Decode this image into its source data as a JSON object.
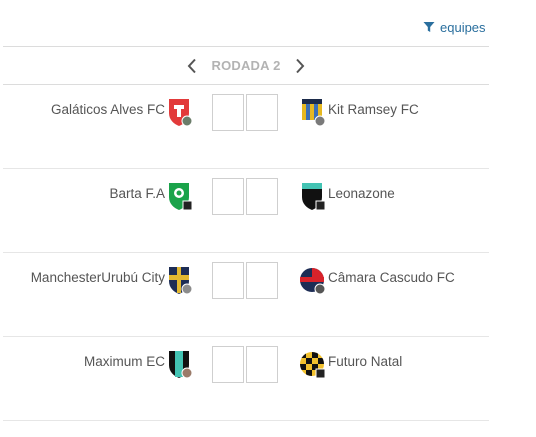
{
  "filter": {
    "label": "equipes",
    "icon": "filter-icon",
    "color": "#2a6f9e"
  },
  "round": {
    "title": "RODADA 2",
    "prev_icon": "chevron-left-icon",
    "next_icon": "chevron-right-icon"
  },
  "matches": [
    {
      "home": {
        "name": "Galáticos Alves FC",
        "crest": "red-white-crest"
      },
      "home_score": "",
      "away_score": "",
      "away": {
        "name": "Kit Ramsey FC",
        "crest": "striped-blue-yellow-crest"
      }
    },
    {
      "home": {
        "name": "Barta F.A",
        "crest": "green-crest"
      },
      "home_score": "",
      "away_score": "",
      "away": {
        "name": "Leonazone",
        "crest": "black-teal-crest"
      }
    },
    {
      "home": {
        "name": "ManchesterUrubú City",
        "crest": "navy-gold-crest"
      },
      "home_score": "",
      "away_score": "",
      "away": {
        "name": "Câmara Cascudo FC",
        "crest": "red-navy-crest"
      }
    },
    {
      "home": {
        "name": "Maximum EC",
        "crest": "black-teal-crest"
      },
      "home_score": "",
      "away_score": "",
      "away": {
        "name": "Futuro Natal",
        "crest": "yellow-black-checkered-crest"
      }
    }
  ]
}
